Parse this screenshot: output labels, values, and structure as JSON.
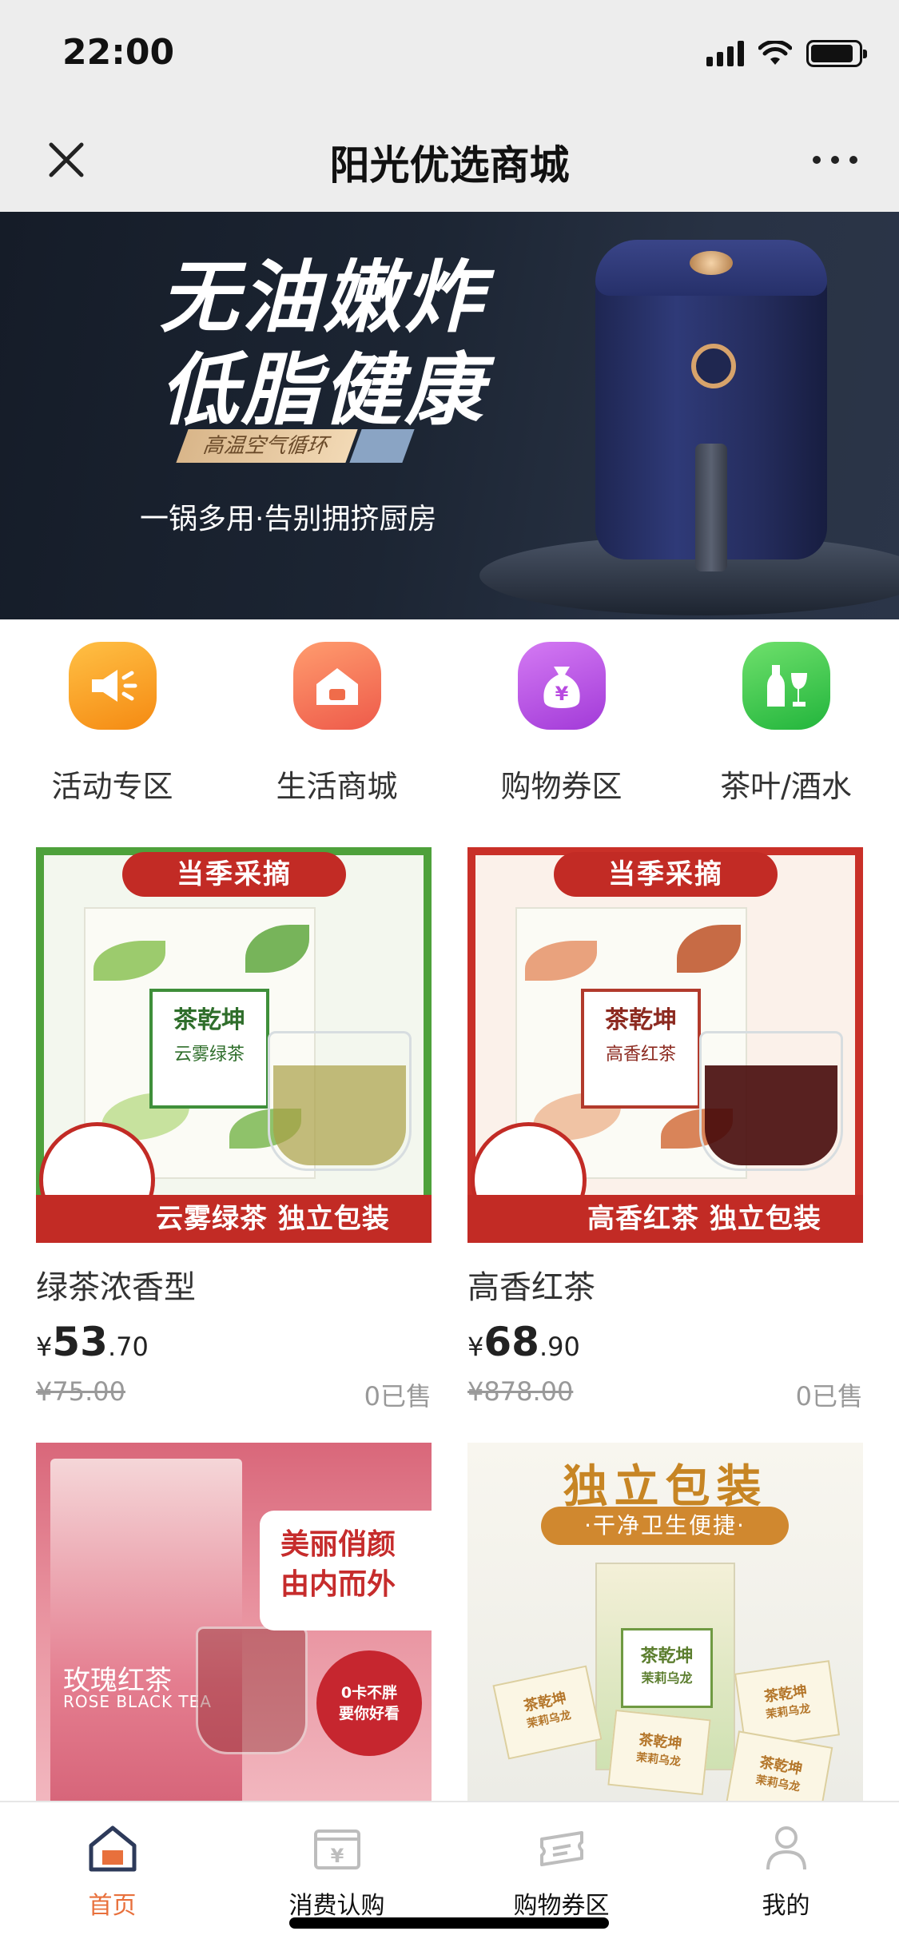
{
  "status_bar": {
    "time": "22:00"
  },
  "nav": {
    "title": "阳光优选商城"
  },
  "banner": {
    "headline_line1": "无油嫩炸",
    "headline_line2": "低脂健康",
    "tag": "高温空气循环",
    "subtitle": "一锅多用·告别拥挤厨房"
  },
  "categories": [
    {
      "label": "活动专区",
      "icon": "megaphone-icon",
      "color": "#f7a020"
    },
    {
      "label": "生活商城",
      "icon": "house-icon",
      "color": "#f06c4a"
    },
    {
      "label": "购物券区",
      "icon": "money-bag-icon",
      "color": "#b84ae0"
    },
    {
      "label": "茶叶/酒水",
      "icon": "wine-bottle-icon",
      "color": "#34c84a"
    }
  ],
  "products": [
    {
      "name": "绿茶浓香型",
      "price_symbol": "¥",
      "price_int": "53",
      "price_dec": ".70",
      "original_price": "¥75.00",
      "sold": "0已售",
      "image": {
        "ribbon": "当季采摘",
        "box_title": "茶乾坤",
        "box_subtitle": "云雾绿茶",
        "bottom_text": "云雾绿茶 独立包装"
      }
    },
    {
      "name": "高香红茶",
      "price_symbol": "¥",
      "price_int": "68",
      "price_dec": ".90",
      "original_price": "¥878.00",
      "sold": "0已售",
      "image": {
        "ribbon": "当季采摘",
        "box_title": "茶乾坤",
        "box_subtitle": "高香红茶",
        "bottom_text": "高香红茶 独立包装"
      }
    },
    {
      "image": {
        "bag_title": "玫瑰红茶",
        "bag_subtitle": "ROSE BLACK TEA",
        "panel_line1": "美丽俏颜",
        "panel_line2": "由内而外",
        "circle_line1": "0卡不胖",
        "circle_line2": "要你好看"
      }
    },
    {
      "image": {
        "title": "独立包装",
        "ribbon": "·干净卫生便捷·",
        "box_title": "茶乾坤",
        "box_subtitle": "茉莉乌龙",
        "sachet_title": "茶乾坤",
        "sachet_subtitle": "茉莉乌龙"
      }
    }
  ],
  "tabs": [
    {
      "label": "首页",
      "icon": "home-icon",
      "active": true
    },
    {
      "label": "消费认购",
      "icon": "voucher-icon",
      "active": false
    },
    {
      "label": "购物券区",
      "icon": "ticket-icon",
      "active": false
    },
    {
      "label": "我的",
      "icon": "user-icon",
      "active": false
    }
  ],
  "colors": {
    "accent": "#e8703c",
    "brand_red": "#c22b25",
    "tea_green": "#4ea13b"
  }
}
